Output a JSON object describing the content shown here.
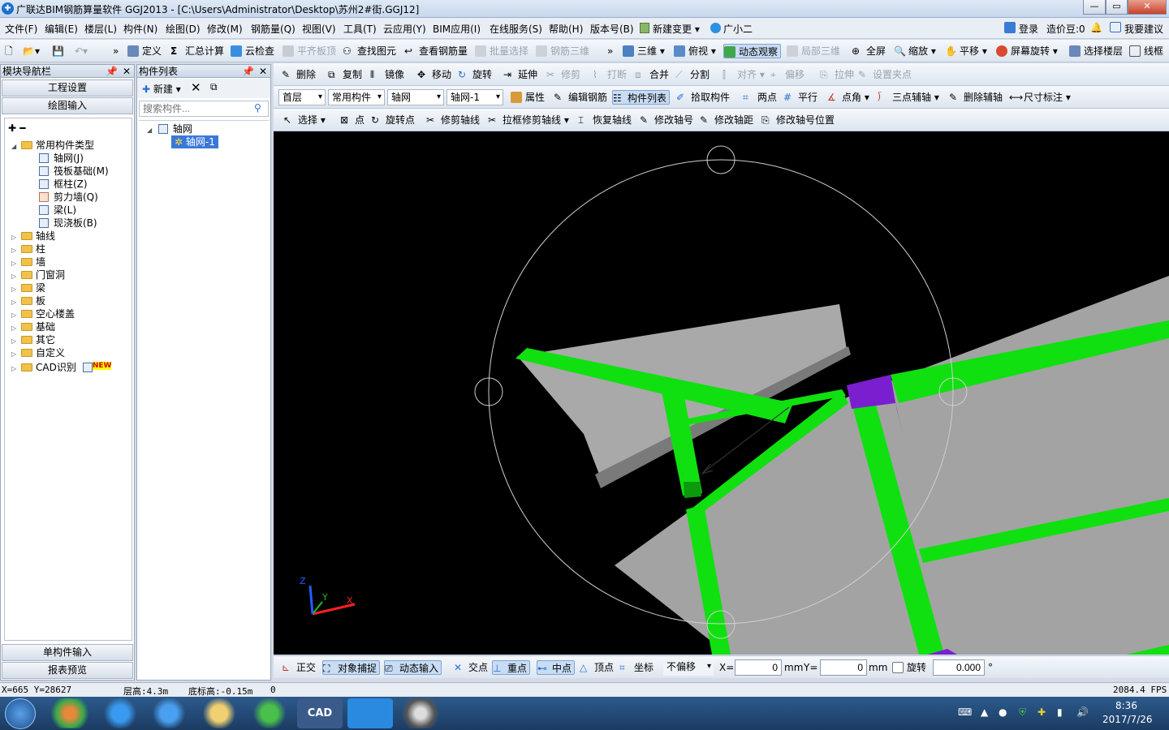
{
  "window": {
    "title": "广联达BIM钢筋算量软件 GGJ2013 - [C:\\Users\\Administrator\\Desktop\\苏州2#街.GGJ12]",
    "min": "—",
    "max": "▭",
    "close": "✕"
  },
  "menubar": {
    "items": [
      "文件(F)",
      "编辑(E)",
      "楼层(L)",
      "构件(N)",
      "绘图(D)",
      "修改(M)",
      "钢筋量(Q)",
      "视图(V)",
      "工具(T)",
      "云应用(Y)",
      "BIM应用(I)",
      "在线服务(S)",
      "帮助(H)",
      "版本号(B)",
      "新建变更",
      "广小二"
    ],
    "login": "登录",
    "cost_bean": "造价豆:0",
    "suggest": "我要建议"
  },
  "toolbar1": {
    "define": "定义",
    "sum": "汇总计算",
    "cloud_check": "云检查",
    "flat_board": "平齐板顶",
    "find": "查找图元",
    "view_rebar": "查看钢筋量",
    "batch_select": "批量选择",
    "rebar3d": "钢筋三维",
    "three_d": "三维",
    "top_view": "俯视",
    "dynamic": "动态观察",
    "local3d": "局部三维",
    "fullscreen": "全屏",
    "zoom": "缩放",
    "pan": "平移",
    "rotate": "屏幕旋转",
    "select_floor": "选择楼层",
    "wireframe": "线框"
  },
  "toolbar2": {
    "delete": "删除",
    "copy": "复制",
    "mirror": "镜像",
    "move": "移动",
    "rotate": "旋转",
    "extend": "延伸",
    "trim": "修剪",
    "break": "打断",
    "merge": "合并",
    "split": "分割",
    "align": "对齐",
    "offset": "偏移",
    "stretch": "拉伸",
    "set_point": "设置夹点"
  },
  "toolbar3": {
    "floor": "首层",
    "category": "常用构件",
    "type": "轴网",
    "instance": "轴网-1",
    "property": "属性",
    "edit_rebar": "编辑钢筋",
    "component_list": "构件列表",
    "pick": "拾取构件",
    "two_point": "两点",
    "parallel": "平行",
    "point_angle": "点角",
    "three_point_aux": "三点辅轴",
    "delete_aux": "删除辅轴",
    "dimension": "尺寸标注"
  },
  "toolbar4": {
    "select": "选择",
    "point": "点",
    "rotate_point": "旋转点",
    "trim_axis": "修剪轴线",
    "box_trim_axis": "拉框修剪轴线",
    "restore_axis": "恢复轴线",
    "modify_axis_no": "修改轴号",
    "modify_axis_dist": "修改轴距",
    "modify_axis_pos": "修改轴号位置"
  },
  "nav": {
    "title": "模块导航栏",
    "project_settings": "工程设置",
    "drawing_input": "绘图输入",
    "tree_root": "常用构件类型",
    "common_items": [
      "轴网(J)",
      "筏板基础(M)",
      "框柱(Z)",
      "剪力墙(Q)",
      "梁(L)",
      "现浇板(B)"
    ],
    "folders": [
      "轴线",
      "柱",
      "墙",
      "门窗洞",
      "梁",
      "板",
      "空心楼盖",
      "基础",
      "其它",
      "自定义",
      "CAD识别"
    ],
    "new_badge": "NEW",
    "single_input": "单构件输入",
    "report_preview": "报表预览"
  },
  "component_list": {
    "title": "构件列表",
    "new_btn": "新建",
    "search_placeholder": "搜索构件...",
    "root": "轴网",
    "child": "轴网-1"
  },
  "statusbar": {
    "ortho": "正交",
    "snap": "对象捕捉",
    "dyn_input": "动态输入",
    "intersection": "交点",
    "perpendicular": "重点",
    "midpoint": "中点",
    "vertex": "顶点",
    "coordinate": "坐标",
    "offset_mode": "不偏移",
    "x_label": "X=",
    "x_value": "0",
    "y_label": "Y=",
    "y_value": "0",
    "unit": "mm",
    "rotate": "旋转",
    "rotate_value": "0.000",
    "degree": "°"
  },
  "bottom": {
    "coords": "X=665 Y=28627",
    "floor_height": "层高:4.3m",
    "base_height": "底标高:-0.15m",
    "extra": "0",
    "fps": "2084.4 FPS"
  },
  "axes": {
    "x": "X",
    "y": "Y",
    "z": "Z"
  },
  "taskbar": {
    "time": "8:36",
    "date": "2017/7/26",
    "cad": "CAD"
  },
  "colors": {
    "beam": "#10e010",
    "slab": "#a8a8a8",
    "column": "#7a1fd0",
    "background": "#000000"
  }
}
